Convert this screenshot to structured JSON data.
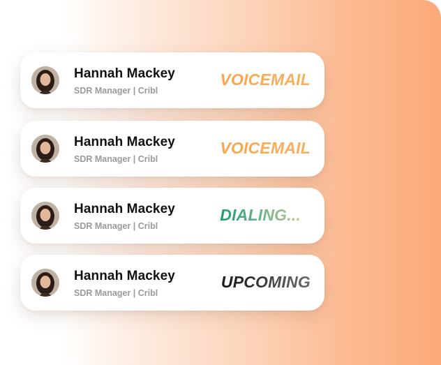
{
  "calls": [
    {
      "name": "Hannah Mackey",
      "role": "SDR Manager | Cribl",
      "status": "VOICEMAIL"
    },
    {
      "name": "Hannah Mackey",
      "role": "SDR Manager | Cribl",
      "status": "VOICEMAIL"
    },
    {
      "name": "Hannah Mackey",
      "role": "SDR Manager | Cribl",
      "status": "DIALING..."
    },
    {
      "name": "Hannah Mackey",
      "role": "SDR Manager | Cribl",
      "status": "UPCOMING"
    }
  ],
  "colors": {
    "voicemail": "#f8a548",
    "dialing": "#1f9e70",
    "upcoming": "#1a1a1a",
    "background_accent": "#fca97a"
  }
}
